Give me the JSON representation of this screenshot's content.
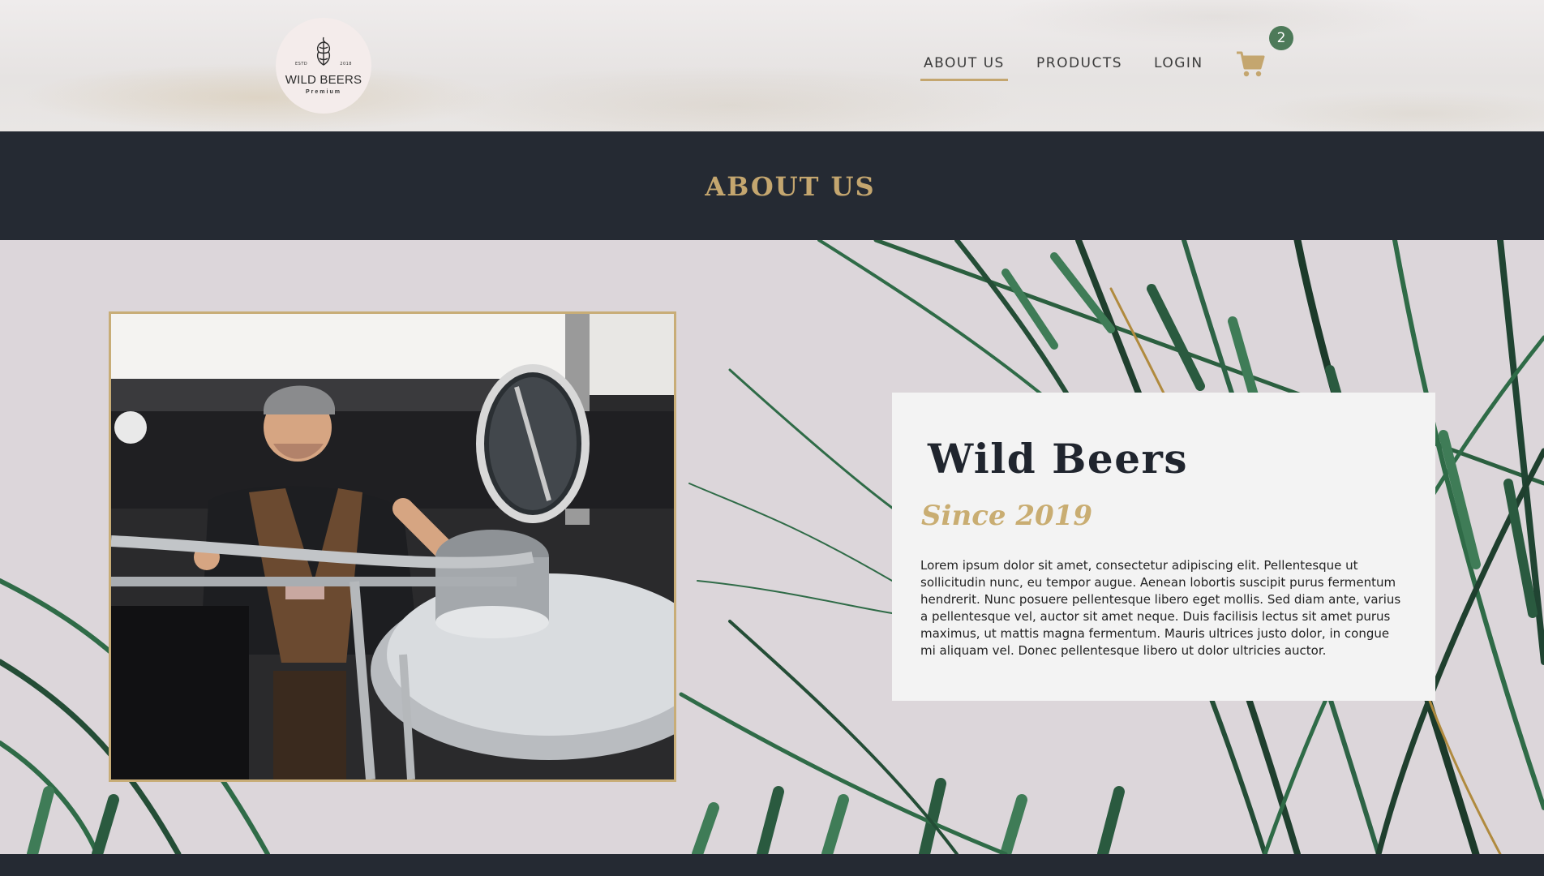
{
  "header": {
    "logo": {
      "estd_left": "ESTD",
      "estd_right": "2018",
      "name": "WILD BEERS",
      "sub": "Premium"
    },
    "nav": [
      {
        "label": "ABOUT US",
        "active": true
      },
      {
        "label": "PRODUCTS",
        "active": false
      },
      {
        "label": "LOGIN",
        "active": false
      }
    ],
    "cart": {
      "icon": "shopping-cart-icon",
      "count": "2"
    }
  },
  "title_band": {
    "title": "ABOUT US"
  },
  "about": {
    "photo": {
      "alt_icon": "brewer-photo"
    },
    "card": {
      "title": "Wild Beers",
      "subtitle": "Since 2019",
      "body": "Lorem ipsum dolor sit amet, consectetur adipiscing elit. Pellentesque ut sollicitudin nunc, eu tempor augue. Aenean lobortis suscipit purus fermentum hendrerit. Nunc posuere pellentesque libero eget mollis. Sed diam ante, varius a pellentesque vel, auctor sit amet neque. Duis facilisis lectus sit amet purus maximus, ut mattis magna fermentum. Mauris ultrices justo dolor, in congue mi aliquam vel. Donec pellentesque libero ut dolor ultricies auctor."
    }
  },
  "colors": {
    "accent_gold": "#c4a66f",
    "dark": "#252a33",
    "badge_green": "#4d7a59",
    "section_bg": "#dcd6da",
    "leaf_green": "#2f6b47"
  }
}
